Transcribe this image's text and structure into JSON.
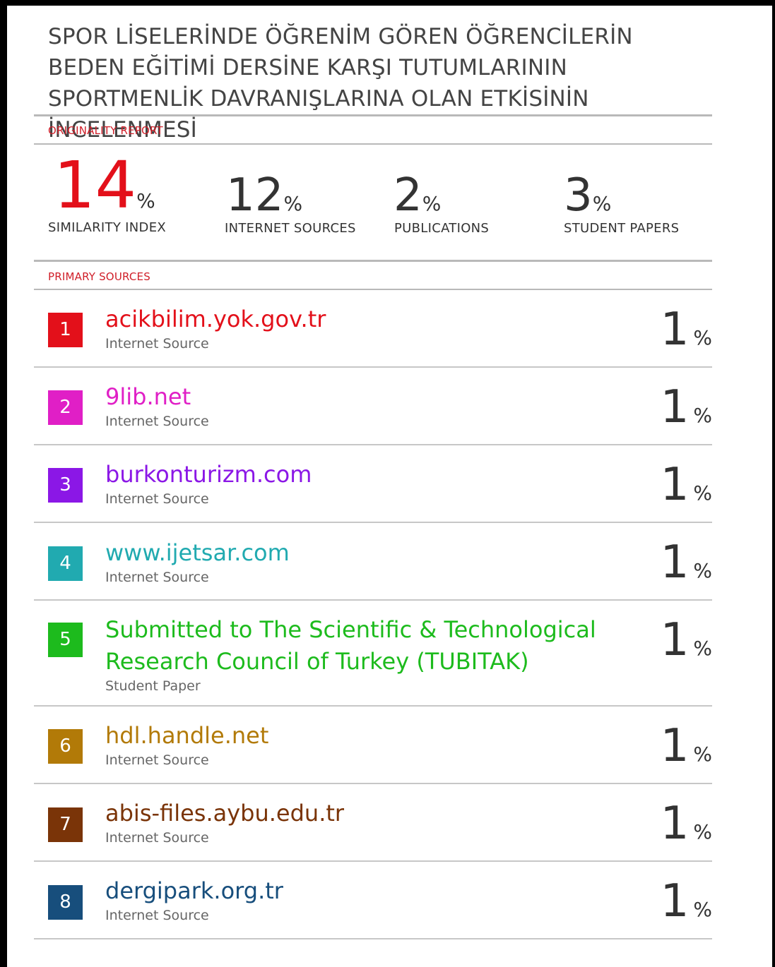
{
  "title": "SPOR LİSELERİNDE ÖĞRENİM GÖREN ÖĞRENCİLERİN BEDEN EĞİTİMİ DERSİNE KARŞI TUTUMLARININ SPORTMENLİK DAVRANIŞLARINA OLAN ETKİSİNİN İNCELENMESİ",
  "originality_label": "ORIGINALITY REPORT",
  "primary_label": "PRIMARY SOURCES",
  "percent_sign": "%",
  "stats": [
    {
      "value": "14",
      "label": "SIMILARITY INDEX"
    },
    {
      "value": "12",
      "label": "INTERNET SOURCES"
    },
    {
      "value": "2",
      "label": "PUBLICATIONS"
    },
    {
      "value": "3",
      "label": "STUDENT PAPERS"
    }
  ],
  "colors": {
    "accent": "#e3101a",
    "badges": [
      "#e3101a",
      "#e01fc6",
      "#8b17e6",
      "#21aab0",
      "#1dbb1d",
      "#b27a08",
      "#7a3408",
      "#174e7c"
    ]
  },
  "sources": [
    {
      "rank": "1",
      "name": "acikbilim.yok.gov.tr",
      "type": "Internet Source",
      "share": "1"
    },
    {
      "rank": "2",
      "name": "9lib.net",
      "type": "Internet Source",
      "share": "1"
    },
    {
      "rank": "3",
      "name": "burkonturizm.com",
      "type": "Internet Source",
      "share": "1"
    },
    {
      "rank": "4",
      "name": "www.ijetsar.com",
      "type": "Internet Source",
      "share": "1"
    },
    {
      "rank": "5",
      "name": "Submitted to The Scientific & Technological",
      "name2": "Research Council of Turkey (TUBITAK)",
      "type": "Student Paper",
      "share": "1"
    },
    {
      "rank": "6",
      "name": "hdl.handle.net",
      "type": "Internet Source",
      "share": "1"
    },
    {
      "rank": "7",
      "name": "abis-files.aybu.edu.tr",
      "type": "Internet Source",
      "share": "1"
    },
    {
      "rank": "8",
      "name": "dergipark.org.tr",
      "type": "Internet Source",
      "share": "1"
    }
  ]
}
